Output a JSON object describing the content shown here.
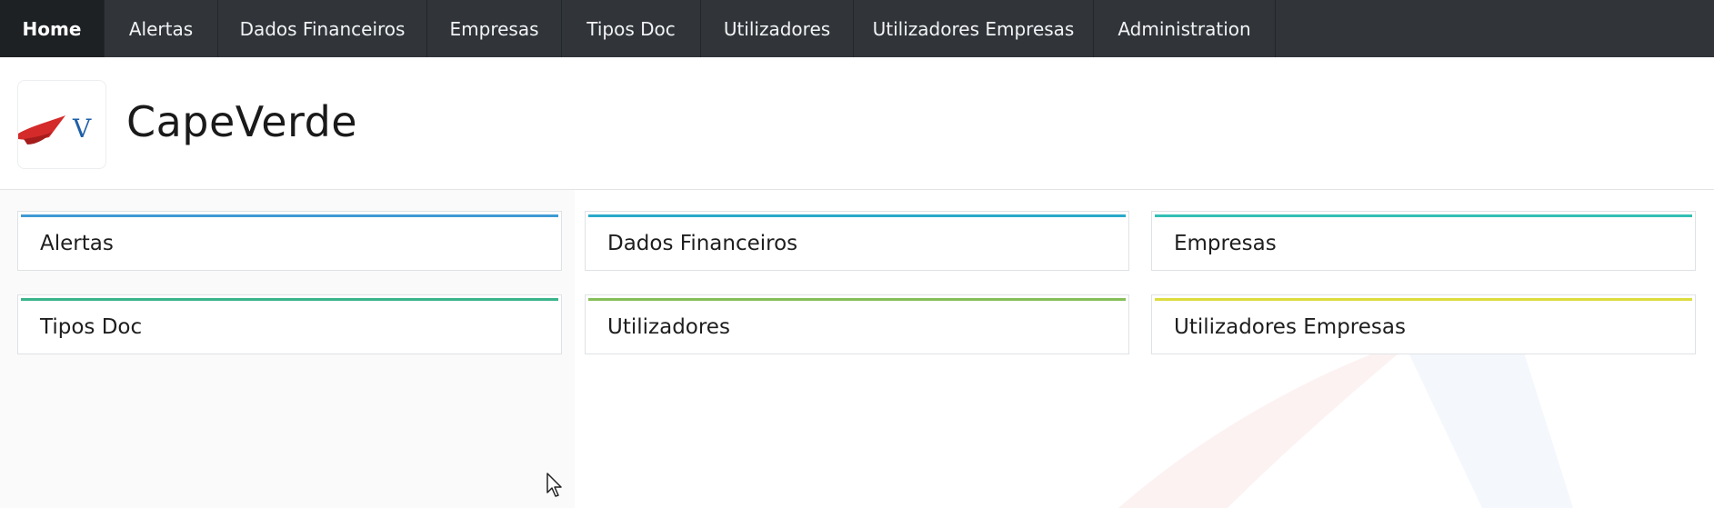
{
  "nav": {
    "items": [
      {
        "label": "Home",
        "active": true
      },
      {
        "label": "Alertas"
      },
      {
        "label": "Dados Financeiros"
      },
      {
        "label": "Empresas"
      },
      {
        "label": "Tipos Doc"
      },
      {
        "label": "Utilizadores"
      },
      {
        "label": "Utilizadores Empresas"
      },
      {
        "label": "Administration"
      }
    ]
  },
  "header": {
    "title": "CapeVerde",
    "logo_icon": "capeverde-logo-icon",
    "logo_text": "V"
  },
  "cards": [
    {
      "label": "Alertas",
      "accent": "#3f9ad3"
    },
    {
      "label": "Dados Financeiros",
      "accent": "#2aa9c9"
    },
    {
      "label": "Empresas",
      "accent": "#33bfb4"
    },
    {
      "label": "Tipos Doc",
      "accent": "#3ab48a"
    },
    {
      "label": "Utilizadores",
      "accent": "#86be5a"
    },
    {
      "label": "Utilizadores Empresas",
      "accent": "#dcdc3e"
    }
  ],
  "colors": {
    "navbar_bg": "#31353a",
    "navbar_active": "#1e2124",
    "logo_red": "#d42a2a",
    "logo_blue": "#1f5fa8"
  }
}
